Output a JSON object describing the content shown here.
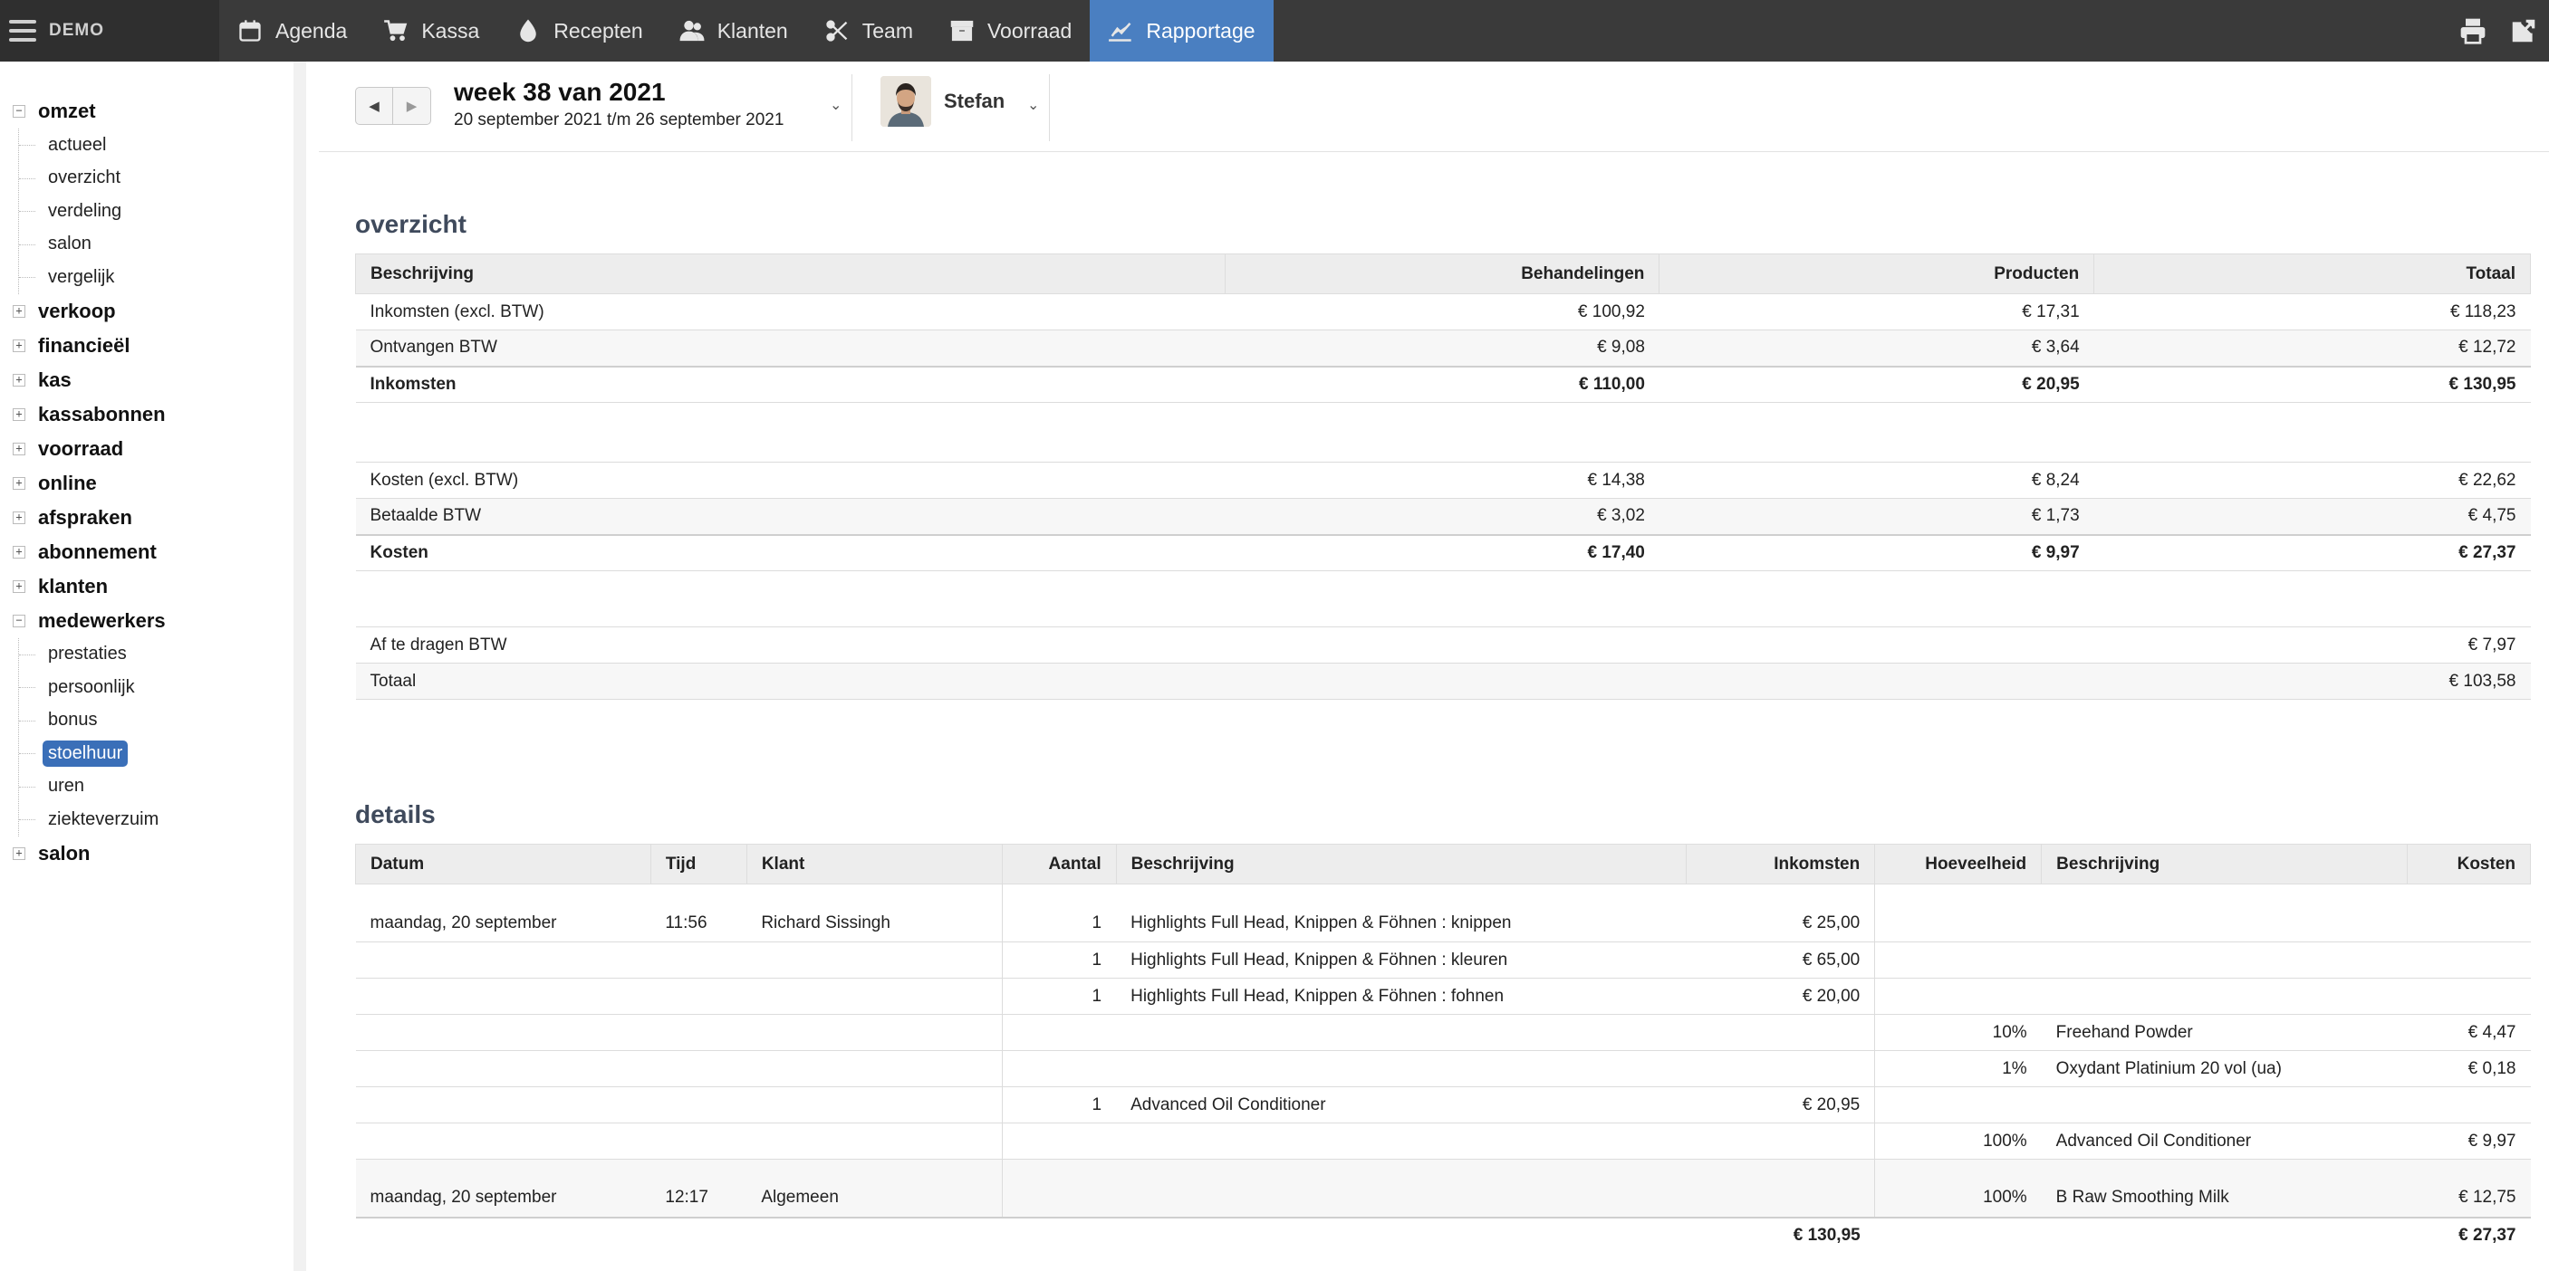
{
  "topbar": {
    "brand": "DEMO",
    "nav": [
      {
        "label": "Agenda",
        "icon": "calendar-icon"
      },
      {
        "label": "Kassa",
        "icon": "cart-icon"
      },
      {
        "label": "Recepten",
        "icon": "drop-icon"
      },
      {
        "label": "Klanten",
        "icon": "users-icon"
      },
      {
        "label": "Team",
        "icon": "scissors-icon"
      },
      {
        "label": "Voorraad",
        "icon": "box-icon"
      },
      {
        "label": "Rapportage",
        "icon": "chart-line-icon"
      }
    ],
    "active": "Rapportage",
    "accent_color": "#4a7fc1"
  },
  "sidebar": {
    "groups": [
      {
        "label": "omzet",
        "expanded": true,
        "children": [
          "actueel",
          "overzicht",
          "verdeling",
          "salon",
          "vergelijk"
        ]
      },
      {
        "label": "verkoop",
        "expanded": false
      },
      {
        "label": "financieël",
        "expanded": false
      },
      {
        "label": "kas",
        "expanded": false
      },
      {
        "label": "kassabonnen",
        "expanded": false
      },
      {
        "label": "voorraad",
        "expanded": false
      },
      {
        "label": "online",
        "expanded": false
      },
      {
        "label": "afspraken",
        "expanded": false
      },
      {
        "label": "abonnement",
        "expanded": false
      },
      {
        "label": "klanten",
        "expanded": false
      },
      {
        "label": "medewerkers",
        "expanded": true,
        "children": [
          "prestaties",
          "persoonlijk",
          "bonus",
          "stoelhuur",
          "uren",
          "ziekteverzuim"
        ]
      },
      {
        "label": "salon",
        "expanded": false
      }
    ],
    "selected": "stoelhuur",
    "toggle_collapsed": "+",
    "toggle_expanded": "−"
  },
  "toolbar": {
    "prev_label": "◀",
    "next_label": "▶",
    "week_title": "week 38 van 2021",
    "week_range": "20 september 2021 t/m 26 september 2021",
    "employee": "Stefan",
    "chevron": "⌄"
  },
  "overzicht": {
    "title": "overzicht",
    "headers": [
      "Beschrijving",
      "Behandelingen",
      "Producten",
      "Totaal"
    ],
    "income_rows": [
      [
        "Inkomsten (excl. BTW)",
        "€ 100,92",
        "€ 17,31",
        "€ 118,23"
      ],
      [
        "Ontvangen BTW",
        "€ 9,08",
        "€ 3,64",
        "€ 12,72"
      ]
    ],
    "income_total": [
      "Inkomsten",
      "€ 110,00",
      "€ 20,95",
      "€ 130,95"
    ],
    "cost_rows": [
      [
        "Kosten (excl. BTW)",
        "€ 14,38",
        "€ 8,24",
        "€ 22,62"
      ],
      [
        "Betaalde BTW",
        "€ 3,02",
        "€ 1,73",
        "€ 4,75"
      ]
    ],
    "cost_total": [
      "Kosten",
      "€ 17,40",
      "€ 9,97",
      "€ 27,37"
    ],
    "btw_label": "Af te dragen BTW",
    "btw_value": "€ 7,97",
    "total_label": "Totaal",
    "total_value": "€ 103,58"
  },
  "details": {
    "title": "details",
    "headers": [
      "Datum",
      "Tijd",
      "Klant",
      "Aantal",
      "Beschrijving",
      "Inkomsten",
      "Hoeveelheid",
      "Beschrijving",
      "Kosten"
    ],
    "rows": [
      [
        "maandag, 20 september",
        "11:56",
        "Richard Sissingh",
        "1",
        "Highlights Full Head, Knippen & Föhnen : knippen",
        "€ 25,00",
        "",
        "",
        ""
      ],
      [
        "",
        "",
        "",
        "1",
        "Highlights Full Head, Knippen & Föhnen : kleuren",
        "€ 65,00",
        "",
        "",
        ""
      ],
      [
        "",
        "",
        "",
        "1",
        "Highlights Full Head, Knippen & Föhnen : fohnen",
        "€ 20,00",
        "",
        "",
        ""
      ],
      [
        "",
        "",
        "",
        "",
        "",
        "",
        "10%",
        "Freehand Powder",
        "€ 4,47"
      ],
      [
        "",
        "",
        "",
        "",
        "",
        "",
        "1%",
        "Oxydant Platinium 20 vol (ua)",
        "€ 0,18"
      ],
      [
        "",
        "",
        "",
        "1",
        "Advanced Oil Conditioner",
        "€ 20,95",
        "",
        "",
        ""
      ],
      [
        "",
        "",
        "",
        "",
        "",
        "",
        "100%",
        "Advanced Oil Conditioner",
        "€ 9,97"
      ],
      [
        "maandag, 20 september",
        "12:17",
        "Algemeen",
        "",
        "",
        "",
        "100%",
        "B Raw Smoothing Milk",
        "€ 12,75"
      ]
    ],
    "total_income": "€ 130,95",
    "total_costs": "€ 27,37"
  }
}
